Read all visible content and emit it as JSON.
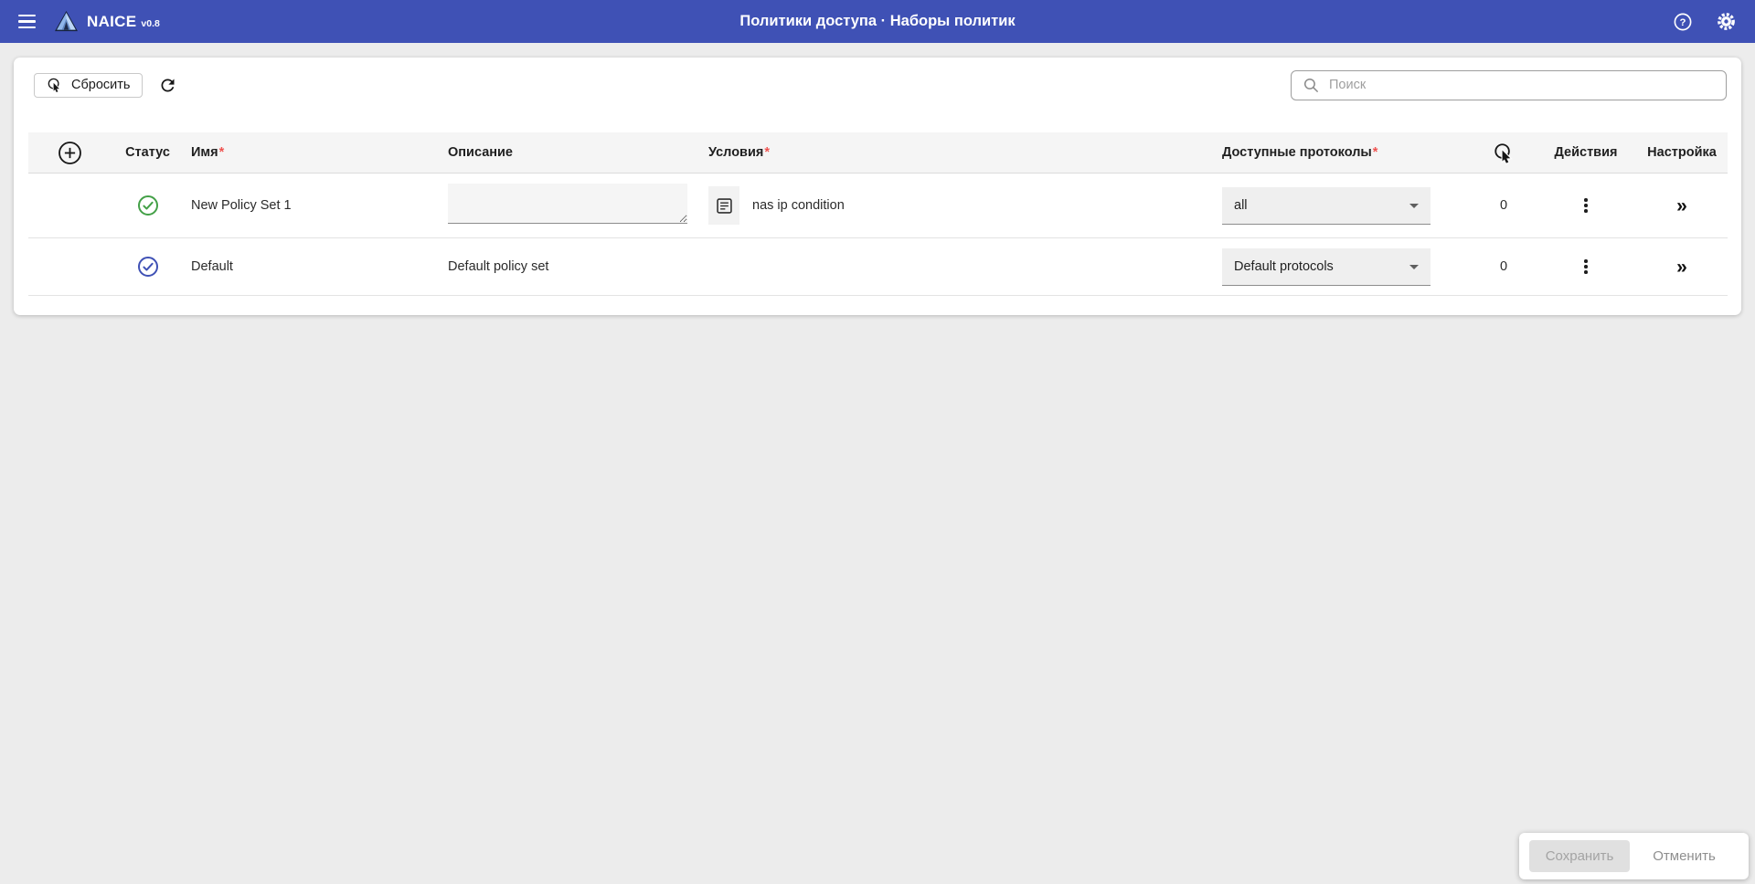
{
  "header": {
    "brand": "NAICE",
    "version": "v0.8",
    "title": "Политики доступа · Наборы политик"
  },
  "toolbar": {
    "reset_label": "Сбросить",
    "search_placeholder": "Поиск",
    "search_value": ""
  },
  "table": {
    "headers": {
      "status": "Статус",
      "name": "Имя",
      "description": "Описание",
      "conditions": "Условия",
      "protocols": "Доступные протоколы",
      "actions": "Действия",
      "settings": "Настройка",
      "required_marker": "*"
    },
    "rows": [
      {
        "name": "New Policy Set 1",
        "description": "",
        "condition": "nas ip condition",
        "protocols": "all",
        "hits": "0",
        "status_icon": "check-circle",
        "status_color": "#43a047"
      },
      {
        "name": "Default",
        "description": "Default policy set",
        "condition": "",
        "protocols": "Default protocols",
        "hits": "0",
        "status_icon": "check-circle",
        "status_color": "#3f51b5"
      }
    ]
  },
  "footer": {
    "save_label": "Сохранить",
    "cancel_label": "Отменить"
  },
  "glyphs": {
    "help": "?",
    "settings_chevron": "»"
  },
  "colors": {
    "appbar_bg": "#3f51b5",
    "page_bg": "#ececec",
    "status_green": "#43a047",
    "status_blue": "#3f51b5",
    "required_marker": "#ef5350",
    "table_header_bg": "#f5f5f5"
  }
}
